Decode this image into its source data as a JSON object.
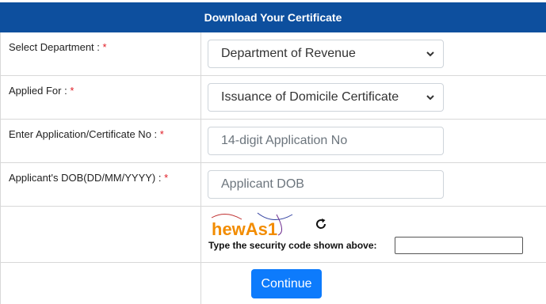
{
  "header": {
    "title": "Download Your Certificate"
  },
  "form": {
    "department": {
      "label": "Select Department : ",
      "required": "*",
      "value": "Department of Revenue"
    },
    "applied_for": {
      "label": "Applied For : ",
      "required": "*",
      "value": "Issuance of Domicile Certificate"
    },
    "application_no": {
      "label": "Enter Application/Certificate No : ",
      "required": "*",
      "placeholder": "14-digit Application No"
    },
    "dob": {
      "label": "Applicant's DOB(DD/MM/YYYY) : ",
      "required": "*",
      "placeholder": "Applicant DOB"
    },
    "captcha": {
      "text": "hewAs1",
      "security_label": "Type the security code shown above:",
      "value": ""
    },
    "continue_label": "Continue"
  },
  "colors": {
    "header_bg": "#0d4f9e",
    "button_bg": "#0d7bfc",
    "required": "#e01b24",
    "captcha_text": "#f28c00"
  },
  "icons": {
    "select": "chevron-down-icon",
    "refresh": "refresh-icon"
  }
}
